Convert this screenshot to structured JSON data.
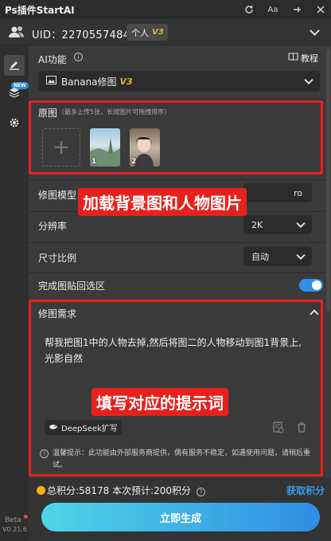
{
  "titlebar": {
    "title": "Ps插件StartAI",
    "icons": [
      "refresh-icon",
      "font-size-icon",
      "pin-icon",
      "close-icon"
    ],
    "font_size_glyph": "Aa"
  },
  "user": {
    "uid": "UID：2270557484",
    "plan": "个人",
    "plan_version": "V3"
  },
  "sidebar": {
    "new_tag": "NEW",
    "beta": "Beta",
    "version": "V0.21.6"
  },
  "ai_function": {
    "label": "AI功能",
    "tutorial": "教程",
    "selected": "Banana修图",
    "selected_version": "V3"
  },
  "original_image": {
    "label": "原图",
    "hint": "（最多上传5张，长按图片可拖拽排序）",
    "thumbnails": [
      {
        "index": "1"
      },
      {
        "index": "2"
      }
    ]
  },
  "model": {
    "label": "修图模型",
    "value_suffix": "ro"
  },
  "resolution": {
    "label": "分辨率",
    "value": "2K"
  },
  "aspect_ratio": {
    "label": "尺寸比例",
    "value": "自动"
  },
  "paste_back": {
    "label": "完成图贴回选区",
    "enabled": true
  },
  "requirement": {
    "label": "修图需求",
    "prompt": "帮我把图1中的人物去掉,然后将图二的人物移动到图1背景上,光影自然",
    "deepseek_label": "DeepSeek扩写",
    "notice": "温馨提示：此功能由外部服务商提供，偶有服务不稳定，如遇使用问题，请稍后重试。"
  },
  "annotations": {
    "upload": "加载背景图和人物图片",
    "prompt": "填写对应的提示词"
  },
  "footer": {
    "points": "总积分:58178  本次预计:200积分",
    "get_points": "获取积分",
    "generate": "立即生成"
  },
  "colors": {
    "accent": "#2f92e6",
    "annotation_red": "#e8201d",
    "gold": "#e0b23b"
  }
}
